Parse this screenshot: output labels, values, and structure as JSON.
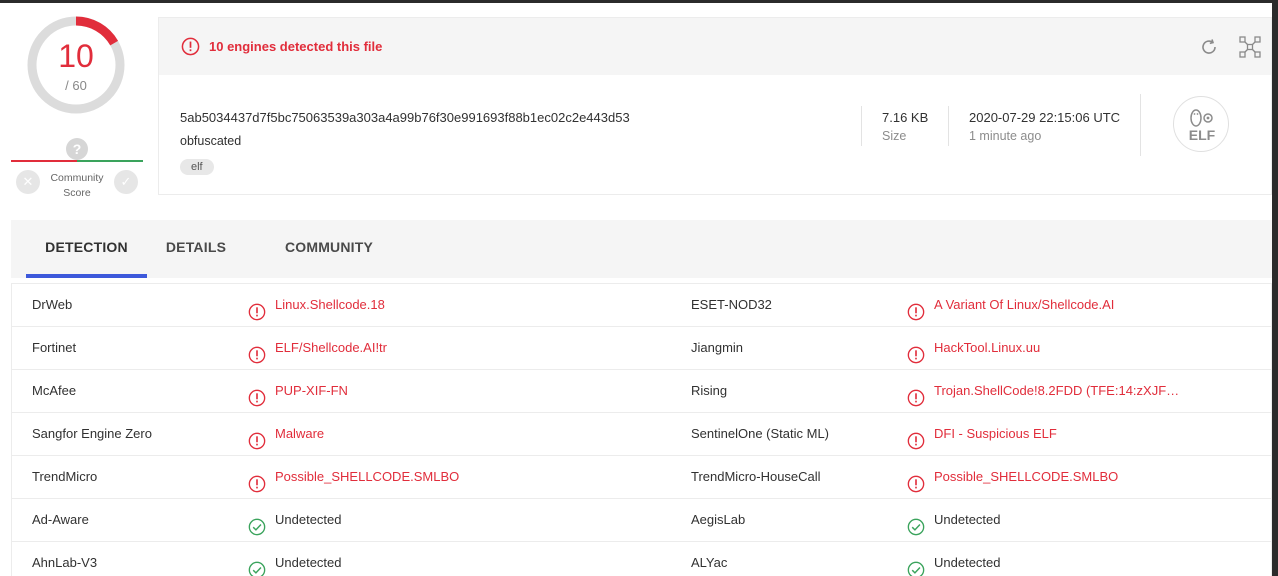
{
  "score": {
    "detected": "10",
    "total": "/ 60",
    "ratio": 0.1667
  },
  "community": {
    "label_line1": "Community",
    "label_line2": "Score",
    "unknown_glyph": "?"
  },
  "alert": {
    "text": "10 engines detected this file",
    "icon": "alert-circle-icon"
  },
  "file": {
    "hash": "5ab5034437d7f5bc75063539a303a4a99b76f30e991693f88b1ec02c2e443d53",
    "name": "obfuscated",
    "tag": "elf",
    "size_value": "7.16 KB",
    "size_label": "Size",
    "date_value": "2020-07-29 22:15:06 UTC",
    "date_label": "1 minute ago",
    "type_icon_text": "ELF"
  },
  "tabs": [
    {
      "label": "DETECTION",
      "active": true
    },
    {
      "label": "DETAILS",
      "active": false
    },
    {
      "label": "COMMUNITY",
      "active": false
    }
  ],
  "colors": {
    "malicious": "#e12d3b",
    "clean": "#3aa35c",
    "accent": "#3d59db"
  },
  "detections": [
    {
      "left_engine": "DrWeb",
      "left_result": "Linux.Shellcode.18",
      "left_status": "malicious",
      "right_engine": "ESET-NOD32",
      "right_result": "A Variant Of Linux/Shellcode.AI",
      "right_status": "malicious"
    },
    {
      "left_engine": "Fortinet",
      "left_result": "ELF/Shellcode.AI!tr",
      "left_status": "malicious",
      "right_engine": "Jiangmin",
      "right_result": "HackTool.Linux.uu",
      "right_status": "malicious"
    },
    {
      "left_engine": "McAfee",
      "left_result": "PUP-XIF-FN",
      "left_status": "malicious",
      "right_engine": "Rising",
      "right_result": "Trojan.ShellCode!8.2FDD (TFE:14:zXJF…",
      "right_status": "malicious"
    },
    {
      "left_engine": "Sangfor Engine Zero",
      "left_result": "Malware",
      "left_status": "malicious",
      "right_engine": "SentinelOne (Static ML)",
      "right_result": "DFI - Suspicious ELF",
      "right_status": "malicious"
    },
    {
      "left_engine": "TrendMicro",
      "left_result": "Possible_SHELLCODE.SMLBO",
      "left_status": "malicious",
      "right_engine": "TrendMicro-HouseCall",
      "right_result": "Possible_SHELLCODE.SMLBO",
      "right_status": "malicious"
    },
    {
      "left_engine": "Ad-Aware",
      "left_result": "Undetected",
      "left_status": "clean",
      "right_engine": "AegisLab",
      "right_result": "Undetected",
      "right_status": "clean"
    },
    {
      "left_engine": "AhnLab-V3",
      "left_result": "Undetected",
      "left_status": "clean",
      "right_engine": "ALYac",
      "right_result": "Undetected",
      "right_status": "clean"
    }
  ]
}
